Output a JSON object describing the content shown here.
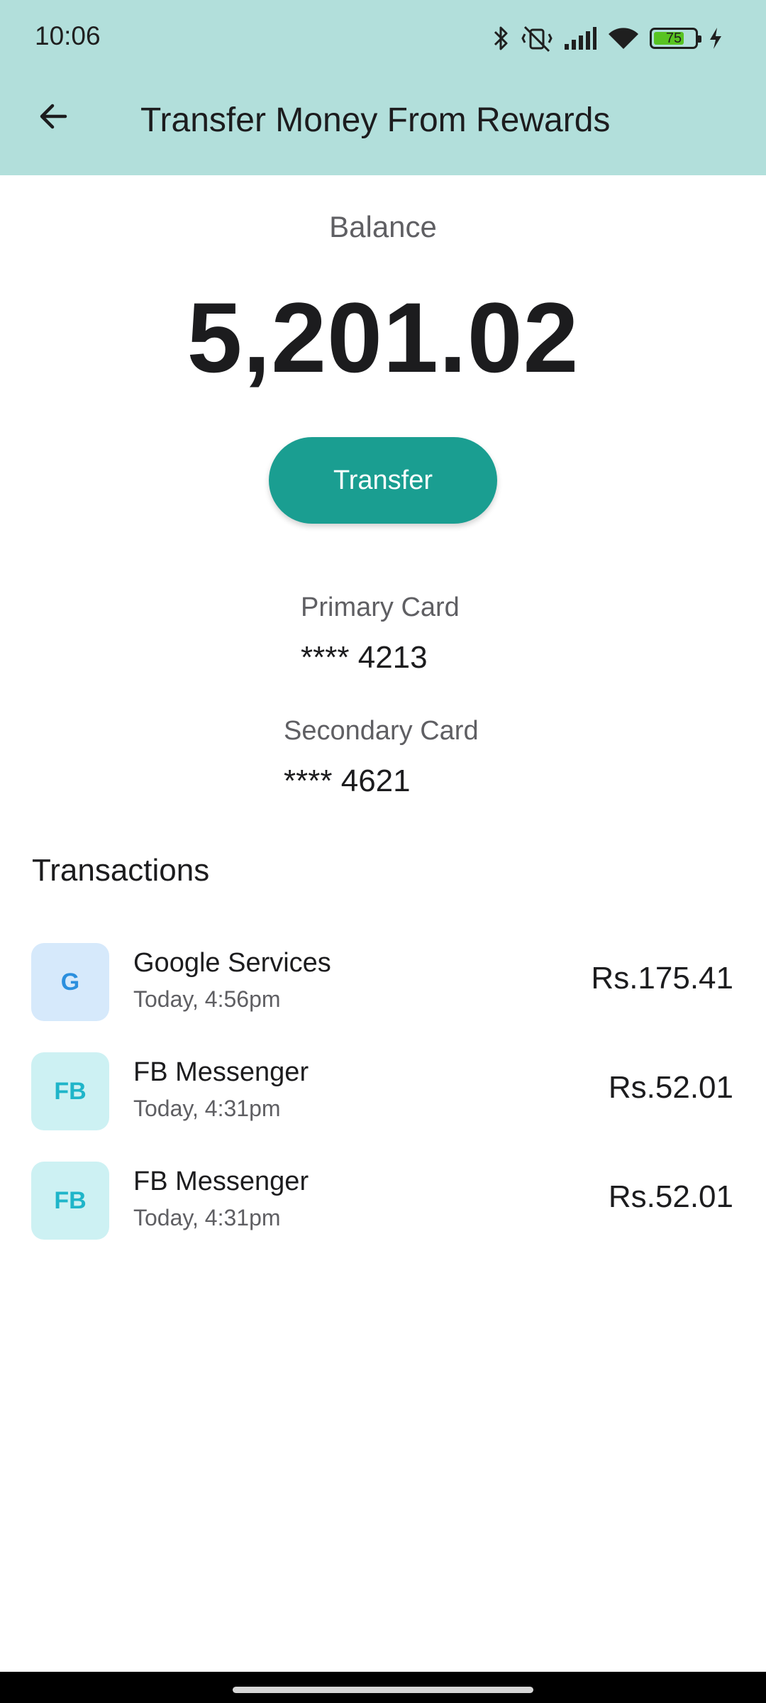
{
  "status_bar": {
    "time": "10:06",
    "battery_level": "75",
    "icons": [
      "bluetooth-icon",
      "vibrate-off-icon",
      "signal-icon",
      "wifi-icon",
      "battery-icon",
      "charging-icon"
    ]
  },
  "header": {
    "title": "Transfer Money From Rewards",
    "back_icon": "arrow-back-icon",
    "background": "#b2dfdb"
  },
  "balance": {
    "label": "Balance",
    "value": "5,201.02"
  },
  "transfer_button": {
    "label": "Transfer",
    "color": "#1a9e91"
  },
  "cards": [
    {
      "label": "Primary Card",
      "number": "**** 4213"
    },
    {
      "label": "Secondary Card",
      "number": "**** 4621"
    }
  ],
  "transactions": {
    "title": "Transactions",
    "items": [
      {
        "initials": "G",
        "name": "Google Services",
        "time": "Today, 4:56pm",
        "amount": "Rs.175.41",
        "avatar_bg": "#d6e9fb",
        "avatar_fg": "#2b8fde"
      },
      {
        "initials": "FB",
        "name": "FB Messenger",
        "time": "Today, 4:31pm",
        "amount": "Rs.52.01",
        "avatar_bg": "#cdf1f3",
        "avatar_fg": "#1fb5c9"
      },
      {
        "initials": "FB",
        "name": "FB Messenger",
        "time": "Today, 4:31pm",
        "amount": "Rs.52.01",
        "avatar_bg": "#cdf1f3",
        "avatar_fg": "#1fb5c9"
      }
    ]
  }
}
